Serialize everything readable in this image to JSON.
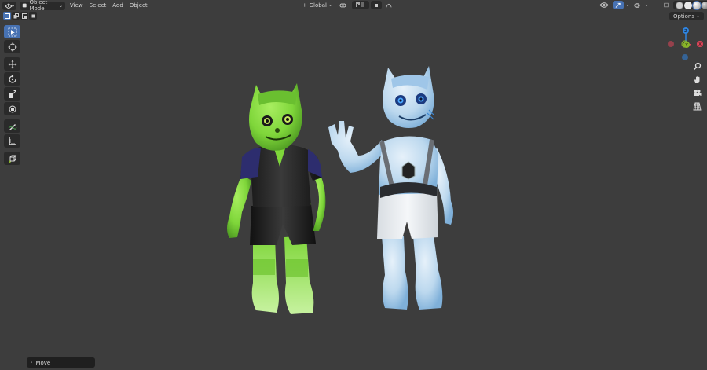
{
  "header": {
    "mode_label": "Object Mode",
    "menus": [
      "View",
      "Select",
      "Add",
      "Object"
    ],
    "transform_orientation": "Global",
    "options_label": "Options"
  },
  "colors": {
    "viewport_bg": "#3d3d3d",
    "accent": "#4772b3",
    "panel_bg": "#2a2a2a",
    "gizmo_x": "#e0465a",
    "gizmo_y": "#8ab629",
    "gizmo_z": "#2f84e0"
  },
  "gizmo": {
    "z_label": "Z",
    "y_label": "Y",
    "x_label": "X"
  },
  "tools": [
    "select-box",
    "cursor",
    "move",
    "rotate",
    "scale",
    "transform",
    "annotate",
    "measure",
    "add-cube"
  ],
  "operator_panel": {
    "label": "Move"
  }
}
